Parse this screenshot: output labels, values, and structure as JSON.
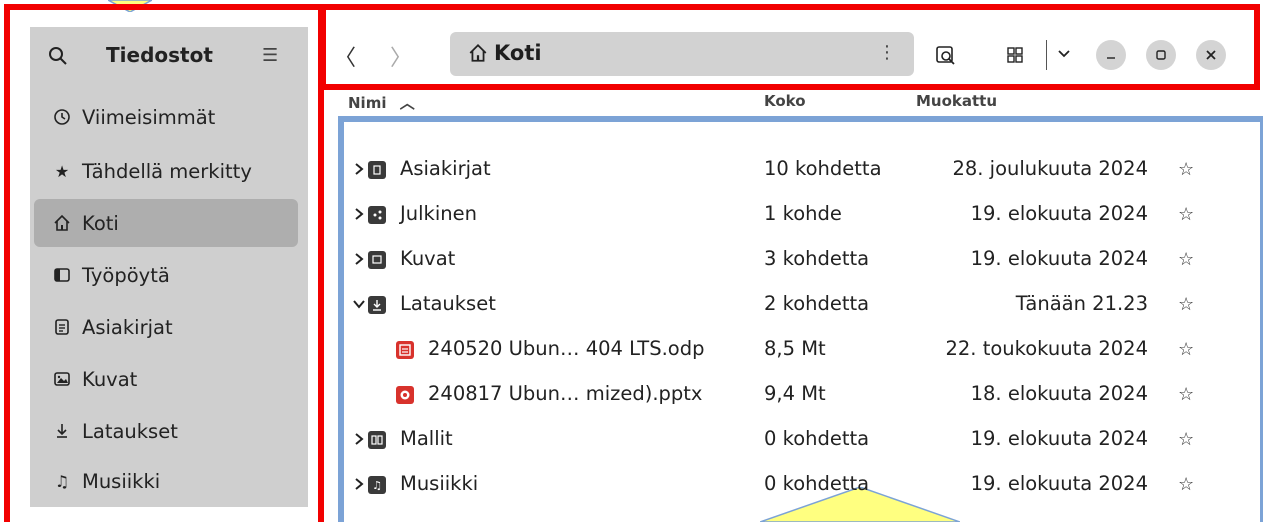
{
  "sidebar": {
    "title": "Tiedostot",
    "items": [
      {
        "label": "Viimeisimmät",
        "icon": "clock-icon"
      },
      {
        "label": "Tähdellä merkitty",
        "icon": "star-icon"
      },
      {
        "label": "Koti",
        "icon": "home-icon",
        "active": true
      },
      {
        "label": "Työpöytä",
        "icon": "desktop-icon"
      },
      {
        "label": "Asiakirjat",
        "icon": "document-icon"
      },
      {
        "label": "Kuvat",
        "icon": "image-icon"
      },
      {
        "label": "Lataukset",
        "icon": "download-icon"
      },
      {
        "label": "Musiikki",
        "icon": "music-icon"
      }
    ]
  },
  "header": {
    "path_label": "Koti"
  },
  "columns": {
    "name": "Nimi",
    "size": "Koko",
    "modified": "Muokattu"
  },
  "files": [
    {
      "name": "Asiakirjat",
      "size": "10 kohdetta",
      "modified": "28. joulukuuta 2024",
      "type": "folder",
      "icon": "folder-documents-icon",
      "expander": "collapsed"
    },
    {
      "name": "Julkinen",
      "size": "1 kohde",
      "modified": "19. elokuuta 2024",
      "type": "folder",
      "icon": "folder-public-icon",
      "expander": "collapsed"
    },
    {
      "name": "Kuvat",
      "size": "3 kohdetta",
      "modified": "19. elokuuta 2024",
      "type": "folder",
      "icon": "folder-pictures-icon",
      "expander": "collapsed"
    },
    {
      "name": "Lataukset",
      "size": "2 kohdetta",
      "modified": "Tänään 21.23",
      "type": "folder",
      "icon": "folder-download-icon",
      "expander": "expanded"
    },
    {
      "name": "240520 Ubun… 404 LTS.odp",
      "size": "8,5 Mt",
      "modified": "22. toukokuuta 2024",
      "type": "file",
      "icon": "presentation-odp-icon",
      "indent": true
    },
    {
      "name": "240817 Ubun… mized).pptx",
      "size": "9,4 Mt",
      "modified": "18. elokuuta 2024",
      "type": "file",
      "icon": "presentation-pptx-icon",
      "indent": true
    },
    {
      "name": "Mallit",
      "size": "0 kohdetta",
      "modified": "19. elokuuta 2024",
      "type": "folder",
      "icon": "folder-templates-icon",
      "expander": "collapsed"
    },
    {
      "name": "Musiikki",
      "size": "0 kohdetta",
      "modified": "19. elokuuta 2024",
      "type": "folder",
      "icon": "folder-music-icon",
      "expander": "collapsed"
    }
  ],
  "colors": {
    "annotation_red": "#f20000",
    "annotation_blue": "#7ca3d6",
    "callout_yellow": "#ffff80",
    "sidebar_bg": "#cfcfcf",
    "sidebar_active": "#aeaeae",
    "folder_icon": "#3a3a3a",
    "file_red": "#d8322c"
  }
}
